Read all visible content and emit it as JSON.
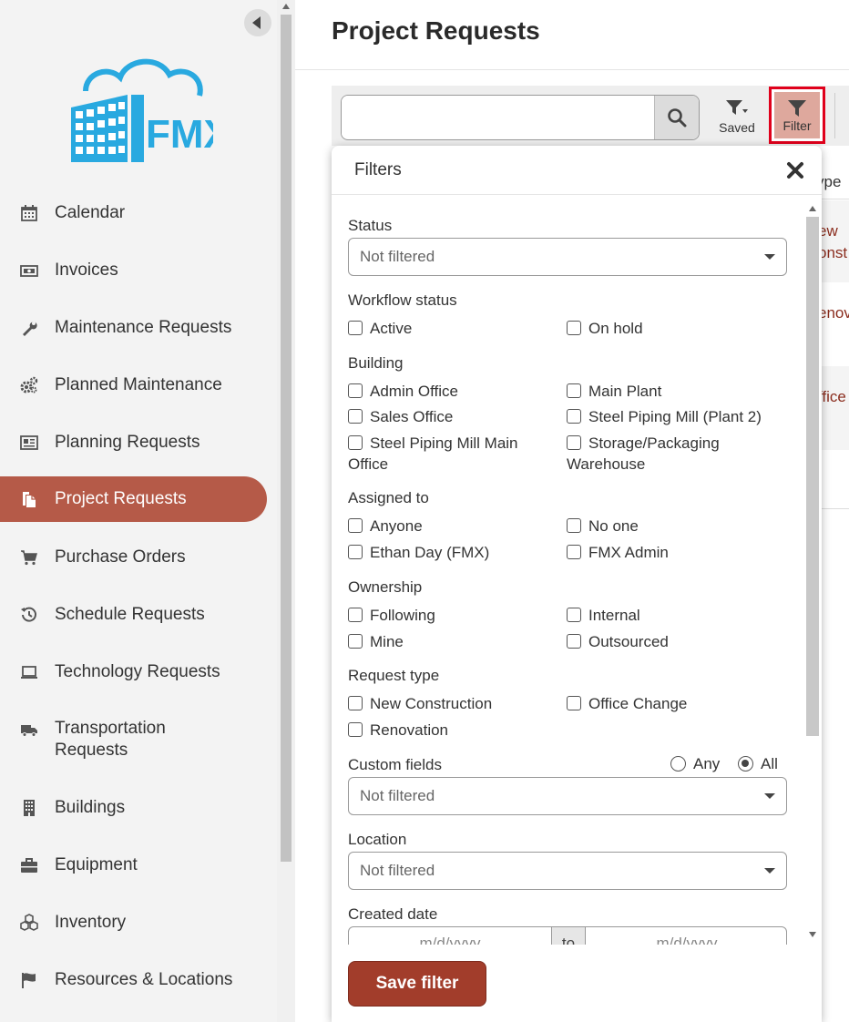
{
  "colors": {
    "accent": "#b55a48",
    "save_button": "#a23d2b",
    "filter_highlight": "#e0001b",
    "logo": "#29a9e0"
  },
  "sidebar": {
    "logo_text": "FMX",
    "items": [
      {
        "label": "Calendar",
        "icon": "calendar-icon"
      },
      {
        "label": "Invoices",
        "icon": "invoice-icon"
      },
      {
        "label": "Maintenance Requests",
        "icon": "wrench-icon"
      },
      {
        "label": "Planned Maintenance",
        "icon": "gears-icon"
      },
      {
        "label": "Planning Requests",
        "icon": "newspaper-icon"
      },
      {
        "label": "Project Requests",
        "icon": "copy-document-icon",
        "active": true
      },
      {
        "label": "Purchase Orders",
        "icon": "cart-icon"
      },
      {
        "label": "Schedule Requests",
        "icon": "history-icon"
      },
      {
        "label": "Technology Requests",
        "icon": "laptop-icon"
      },
      {
        "label": "Transportation Requests",
        "icon": "truck-icon"
      },
      {
        "label": "Buildings",
        "icon": "building-icon"
      },
      {
        "label": "Equipment",
        "icon": "briefcase-icon"
      },
      {
        "label": "Inventory",
        "icon": "cubes-icon"
      },
      {
        "label": "Resources & Locations",
        "icon": "flag-icon"
      }
    ]
  },
  "header": {
    "title": "Project Requests"
  },
  "toolbar": {
    "search_value": "",
    "saved_label": "Saved",
    "filter_label": "Filter"
  },
  "background_table": {
    "header_fragment": "ype",
    "row_fragments": [
      [
        "ew",
        "onst"
      ],
      [
        "enov"
      ],
      [
        "ffice"
      ]
    ]
  },
  "filters": {
    "title": "Filters",
    "status": {
      "label": "Status",
      "value": "Not filtered"
    },
    "workflow_status": {
      "label": "Workflow status",
      "options": [
        "Active",
        "On hold"
      ]
    },
    "building": {
      "label": "Building",
      "options": [
        "Admin Office",
        "Main Plant",
        "Sales Office",
        "Steel Piping Mill (Plant 2)",
        "Steel Piping Mill Main Office",
        "Storage/Packaging Warehouse"
      ]
    },
    "assigned_to": {
      "label": "Assigned to",
      "options": [
        "Anyone",
        "No one",
        "Ethan Day (FMX)",
        "FMX Admin"
      ]
    },
    "ownership": {
      "label": "Ownership",
      "options": [
        "Following",
        "Internal",
        "Mine",
        "Outsourced"
      ]
    },
    "request_type": {
      "label": "Request type",
      "options": [
        "New Construction",
        "Office Change",
        "Renovation"
      ]
    },
    "custom_fields": {
      "label": "Custom fields",
      "match_any": "Any",
      "match_all": "All",
      "selected": "All",
      "value": "Not filtered"
    },
    "location": {
      "label": "Location",
      "value": "Not filtered"
    },
    "created_date": {
      "label": "Created date",
      "from_placeholder": "m/d/yyyy",
      "to_label": "to",
      "to_placeholder": "m/d/yyyy"
    },
    "save_label": "Save filter"
  }
}
